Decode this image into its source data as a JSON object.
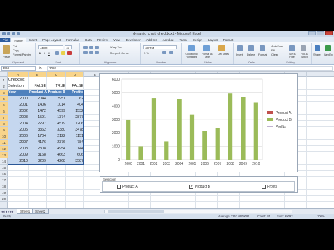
{
  "window": {
    "title": "dynamic_chart_checkbox1 - Microsoft Excel"
  },
  "tabs": [
    "File",
    "Home",
    "Insert",
    "Page Layout",
    "Formulas",
    "Data",
    "Review",
    "View",
    "Developer",
    "Add-Ins",
    "Acrobat",
    "Team",
    "Design",
    "Layout",
    "Format"
  ],
  "ribbon": {
    "clipboard": {
      "paste": "Paste",
      "cut": "Cut",
      "copy": "Copy",
      "format_painter": "Format Painter",
      "label": "Clipboard"
    },
    "font": {
      "name": "Calibri",
      "size": "11",
      "label": "Font"
    },
    "alignment": {
      "wrap": "Wrap Text",
      "merge": "Merge & Center",
      "label": "Alignment"
    },
    "number": {
      "format": "General",
      "label": "Number"
    },
    "styles": {
      "cond": "Conditional Formatting",
      "table": "Format as Table",
      "cell": "Cell Styles",
      "label": "Styles"
    },
    "cells": {
      "insert": "Insert",
      "delete": "Delete",
      "format": "Format",
      "label": "Cells"
    },
    "editing": {
      "autosum": "AutoSum",
      "fill": "Fill",
      "clear": "Clear",
      "sort": "Sort & Filter",
      "find": "Find & Select",
      "label": "Editing"
    },
    "extra": {
      "share": "Share",
      "webex": "WebEx"
    }
  },
  "formula_bar": {
    "name_box": "B10",
    "fx": "fx",
    "content": "2007"
  },
  "columns": [
    "A",
    "B",
    "C",
    "D",
    "E",
    "F",
    "G",
    "H",
    "I",
    "J",
    "K",
    "L",
    "M",
    "N"
  ],
  "rows": [
    "1",
    "2",
    "3",
    "4",
    "5",
    "6",
    "7",
    "8",
    "9",
    "10",
    "11",
    "12",
    "13",
    "14",
    "15",
    "16",
    "17",
    "18",
    "19",
    "20"
  ],
  "cells": {
    "a1": "Checkbox",
    "row2": [
      "Selection",
      "FALSE",
      "TRUE",
      "FALSE"
    ],
    "header": [
      "Year",
      "Product A",
      "Product B",
      "Profits"
    ],
    "data": [
      [
        "2000",
        "2044",
        "2951",
        "62"
      ],
      [
        "2001",
        "1406",
        "1014",
        "404"
      ],
      [
        "2002",
        "1472",
        "4599",
        "1532"
      ],
      [
        "2003",
        "1591",
        "1374",
        "2877"
      ],
      [
        "2004",
        "2297",
        "4519",
        "1206"
      ],
      [
        "2005",
        "3362",
        "3380",
        "3478"
      ],
      [
        "2006",
        "1704",
        "2122",
        "1151"
      ],
      [
        "2007",
        "4176",
        "2376",
        "784"
      ],
      [
        "2008",
        "2308",
        "4954",
        "144"
      ],
      [
        "2009",
        "3168",
        "4663",
        "606"
      ],
      [
        "2010",
        "3209",
        "4268",
        "3587"
      ]
    ]
  },
  "chart_data": {
    "type": "bar",
    "categories": [
      "2000",
      "2001",
      "2002",
      "2003",
      "2004",
      "2005",
      "2006",
      "2007",
      "2008",
      "2009",
      "2010"
    ],
    "series": [
      {
        "name": "Product B",
        "values": [
          2951,
          1014,
          4599,
          1374,
          4519,
          3380,
          2122,
          2376,
          4954,
          4663,
          4268
        ],
        "color": "#9bbb59"
      }
    ],
    "legend_entries": [
      "Product A",
      "Product B",
      "Profits"
    ],
    "legend_colors": [
      "#c0504d",
      "#9bbb59",
      "#8064a2"
    ],
    "yticks": [
      "0",
      "1000",
      "2000",
      "3000",
      "4000",
      "5000",
      "6000"
    ],
    "ylim": [
      0,
      6000
    ],
    "legend_position": "right",
    "grid": true
  },
  "selection_panel": {
    "legend": "Selection",
    "options": [
      {
        "label": "Product A",
        "checked": false
      },
      {
        "label": "Product B",
        "checked": true
      },
      {
        "label": "Profits",
        "checked": false
      }
    ]
  },
  "sheet_tabs": [
    "Sheet1",
    "Sheet2"
  ],
  "status": {
    "ready": "Ready",
    "average": "Average: 2252.0909091",
    "count": "Count: 44",
    "sum": "Sum: 99092",
    "zoom": "100%"
  }
}
